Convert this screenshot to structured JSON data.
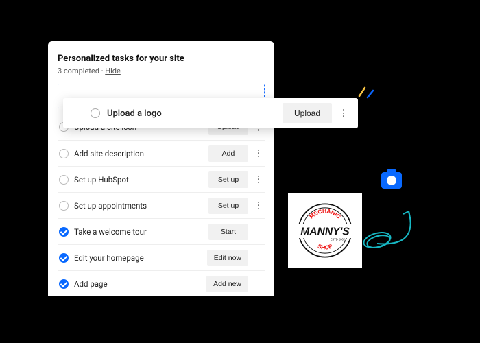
{
  "panel": {
    "title": "Personalized tasks for your site",
    "completed_text": "3 completed",
    "hide_label": "Hide"
  },
  "float_task": {
    "label": "Upload a logo",
    "button": "Upload"
  },
  "tasks": [
    {
      "label": "Upload a site icon",
      "button": "Upload",
      "done": false,
      "menu": true
    },
    {
      "label": "Add site description",
      "button": "Add",
      "done": false,
      "menu": true
    },
    {
      "label": "Set up HubSpot",
      "button": "Set up",
      "done": false,
      "menu": true
    },
    {
      "label": "Set up appointments",
      "button": "Set up",
      "done": false,
      "menu": true
    },
    {
      "label": "Take a welcome tour",
      "button": "Start",
      "done": true,
      "menu": false
    },
    {
      "label": "Edit your homepage",
      "button": "Edit now",
      "done": true,
      "menu": false
    },
    {
      "label": "Add page",
      "button": "Add new",
      "done": true,
      "menu": false
    }
  ],
  "logo": {
    "top_text": "MECHANIC",
    "main_text": "MANNY'S",
    "bottom_text": "SHOP",
    "estd": "ESTD 2002"
  }
}
